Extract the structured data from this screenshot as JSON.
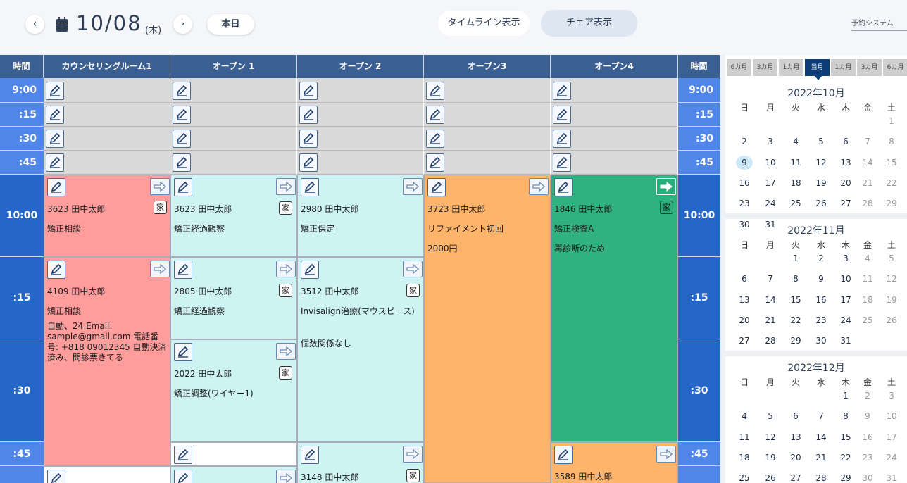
{
  "header": {
    "prev": "‹",
    "next": "›",
    "date": "10/08",
    "weekday": "(木)",
    "today": "本日",
    "timeline": "タイムライン表示",
    "chair": "チェア表示",
    "system": "予約システム"
  },
  "columns": {
    "time": "時間",
    "c1": "カウンセリングルーム1",
    "c2": "オープン 1",
    "c3": "オープン 2",
    "c4": "オープン3",
    "c5": "オープン4"
  },
  "times": [
    "9:00",
    ":15",
    ":30",
    ":45",
    "10:00",
    ":15",
    ":30",
    ":45"
  ],
  "appts": {
    "a1": {
      "l1": "3623 田中太郎",
      "l2": "矯正相談",
      "badge": "家"
    },
    "a2": {
      "l1": "3623 田中太郎",
      "l2": "矯正経過観察",
      "badge": "家"
    },
    "a3": {
      "l1": "2980 田中太郎",
      "l2": "矯正保定"
    },
    "a4": {
      "l1": "3723 田中太郎",
      "l2": "リファイメント初回",
      "l3": "2000円"
    },
    "a5": {
      "l1": "1846 田中太郎",
      "l2": "矯正検査A",
      "l3": "再診断のため",
      "badge": "家"
    },
    "b1": {
      "l1": "4109 田中太郎",
      "l2": "矯正相談",
      "note": "自動、24 Email: sample@gmail.com 電話番号: +818 09012345 自動決済済み、問診票きてる"
    },
    "b2": {
      "l1": "2805 田中太郎",
      "l2": "矯正経過観察",
      "badge": "家"
    },
    "b3": {
      "l1": "3512 田中太郎",
      "l2": "Invisalign治療(マウスピース)",
      "l3": "個数関係なし",
      "badge": "家"
    },
    "c2": {
      "l1": "2022 田中太郎",
      "l2": "矯正調整(ワイヤー1)",
      "badge": "家"
    },
    "d3": {
      "l1": "3148 田中太郎",
      "badge": "家"
    },
    "d5": {
      "l1": "3589 田中太郎"
    }
  },
  "calendar": {
    "tabs": [
      "6カ月",
      "3カ月",
      "1カ月",
      "当月",
      "1カ月",
      "3カ月",
      "6カ月"
    ],
    "weekdays": [
      "日",
      "月",
      "火",
      "水",
      "木",
      "金",
      "土"
    ],
    "months": [
      {
        "title": "2022年10月",
        "days": [
          "1",
          "2",
          "3",
          "4",
          "5",
          "6",
          "7",
          "8",
          "9",
          "10",
          "11",
          "12",
          "13",
          "14",
          "15",
          "16",
          "17",
          "18",
          "19",
          "20",
          "21",
          "22",
          "23",
          "24",
          "25",
          "26",
          "27",
          "28",
          "29",
          "30",
          "31"
        ]
      },
      {
        "title": "2022年11月",
        "days": [
          "1",
          "2",
          "3",
          "4",
          "5",
          "6",
          "7",
          "8",
          "9",
          "10",
          "11",
          "12",
          "13",
          "14",
          "15",
          "16",
          "17",
          "18",
          "19",
          "20",
          "21",
          "22",
          "23",
          "24",
          "25",
          "26",
          "27",
          "28",
          "29",
          "30",
          "31"
        ]
      },
      {
        "title": "2022年12月",
        "days": [
          "1",
          "2",
          "3",
          "4",
          "5",
          "6",
          "7",
          "8",
          "9",
          "10",
          "11",
          "12",
          "13",
          "14",
          "15",
          "16",
          "17",
          "18",
          "19",
          "20",
          "21",
          "22",
          "23",
          "24",
          "25",
          "26",
          "27",
          "28",
          "29",
          "30",
          "31"
        ]
      }
    ]
  },
  "colors": {
    "header": "#3c5f91",
    "counsel": "#ff9c9c",
    "open": "#cdf3f3",
    "refine": "#ffb46b",
    "green": "#2fb27e"
  }
}
